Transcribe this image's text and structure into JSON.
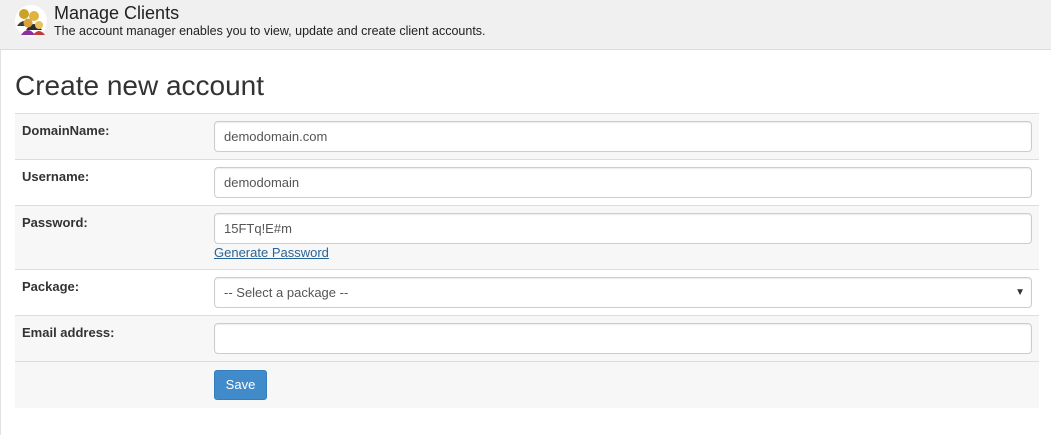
{
  "header": {
    "title": "Manage Clients",
    "description": "The account manager enables you to view, update and create client accounts.",
    "icon": "users-group-icon"
  },
  "page": {
    "title": "Create new account"
  },
  "form": {
    "domain": {
      "label": "DomainName:",
      "value": "demodomain.com"
    },
    "username": {
      "label": "Username:",
      "value": "demodomain"
    },
    "password": {
      "label": "Password:",
      "value": "15FTq!E#m",
      "generate_label": "Generate Password"
    },
    "package": {
      "label": "Package:",
      "selected": "-- Select a package --"
    },
    "email": {
      "label": "Email address:",
      "value": ""
    },
    "save_label": "Save"
  },
  "colors": {
    "primary_button": "#428bca",
    "link": "#2a6496",
    "header_bg": "#f0f0f0"
  }
}
